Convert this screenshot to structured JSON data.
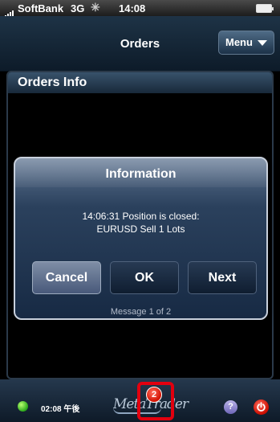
{
  "status_bar": {
    "carrier": "SoftBank",
    "network": "3G",
    "activity_glyph": "✳",
    "time": "14:08"
  },
  "nav": {
    "title": "Orders",
    "menu_label": "Menu"
  },
  "panel": {
    "title": "Orders Info"
  },
  "dialog": {
    "title": "Information",
    "message_line1": "14:06:31 Position is closed:",
    "message_line2": "EURUSD Sell 1 Lots",
    "buttons": {
      "cancel": "Cancel",
      "ok": "OK",
      "next": "Next"
    },
    "footer": "Message 1 of 2"
  },
  "bottom_bar": {
    "time": "02:08 午後",
    "logo_text": "MetaTrader",
    "notification_count": "2",
    "help_glyph": "?",
    "connection_icon": "green-connection-dot",
    "power_icon": "power-icon"
  },
  "colors": {
    "highlight": "#e2000f",
    "badge": "#d31202",
    "connection": "#2aa81a"
  }
}
